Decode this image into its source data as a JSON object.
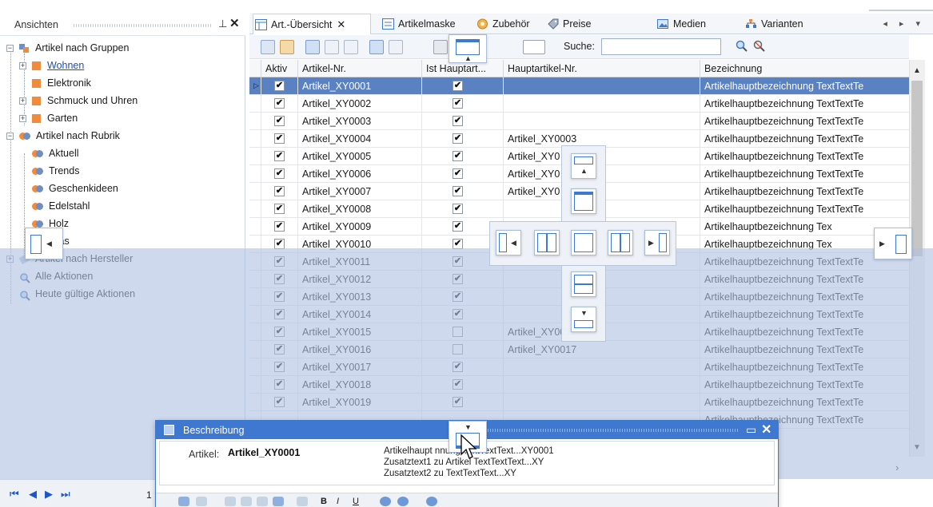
{
  "left_panel": {
    "title": "Ansichten",
    "tree": [
      {
        "label": "Artikel nach Gruppen",
        "level": 0,
        "expander": "−"
      },
      {
        "label": "Wohnen",
        "level": 1,
        "expander": "+"
      },
      {
        "label": "Elektronik",
        "level": 1,
        "expander": ""
      },
      {
        "label": "Schmuck und Uhren",
        "level": 1,
        "expander": "+"
      },
      {
        "label": "Garten",
        "level": 1,
        "expander": "+"
      },
      {
        "label": "Artikel nach Rubrik",
        "level": 0,
        "expander": "−"
      },
      {
        "label": "Aktuell",
        "level": 1,
        "expander": ""
      },
      {
        "label": "Trends",
        "level": 1,
        "expander": ""
      },
      {
        "label": "Geschenkideen",
        "level": 1,
        "expander": ""
      },
      {
        "label": "Edelstahl",
        "level": 1,
        "expander": ""
      },
      {
        "label": "Holz",
        "level": 1,
        "expander": ""
      },
      {
        "label": "Glas",
        "level": 1,
        "expander": ""
      },
      {
        "label": "Artikel nach Hersteller",
        "level": 0,
        "expander": "+"
      },
      {
        "label": "Alle Aktionen",
        "level": 0,
        "expander": ""
      },
      {
        "label": "Heute gültige Aktionen",
        "level": 0,
        "expander": ""
      }
    ]
  },
  "tabs": [
    {
      "label": "Art.-Übersicht",
      "close": "✕"
    },
    {
      "label": "Artikelmaske"
    },
    {
      "label": "Zubehör"
    },
    {
      "label": "Preise"
    },
    {
      "label": "Medien"
    },
    {
      "label": "Varianten"
    }
  ],
  "tab_nav": "◂ ▸ ▾",
  "toolbar": {
    "search_label": "Suche:",
    "search_value": ""
  },
  "grid": {
    "columns": [
      "Aktiv",
      "Artikel-Nr.",
      "Ist Hauptart...",
      "Hauptartikel-Nr.",
      "Bezeichnung"
    ],
    "rows": [
      {
        "aktiv": true,
        "nr": "Artikel_XY0001",
        "haupt": true,
        "haupt_nr": "",
        "bez": "Artikelhauptbezeichnung TextTextTe"
      },
      {
        "aktiv": true,
        "nr": "Artikel_XY0002",
        "haupt": true,
        "haupt_nr": "",
        "bez": "Artikelhauptbezeichnung TextTextTe"
      },
      {
        "aktiv": true,
        "nr": "Artikel_XY0003",
        "haupt": true,
        "haupt_nr": "",
        "bez": "Artikelhauptbezeichnung TextTextTe"
      },
      {
        "aktiv": true,
        "nr": "Artikel_XY0004",
        "haupt": true,
        "haupt_nr": "Artikel_XY0003",
        "bez": "Artikelhauptbezeichnung TextTextTe"
      },
      {
        "aktiv": true,
        "nr": "Artikel_XY0005",
        "haupt": true,
        "haupt_nr": "Artikel_XY0",
        "bez": "Artikelhauptbezeichnung TextTextTe"
      },
      {
        "aktiv": true,
        "nr": "Artikel_XY0006",
        "haupt": true,
        "haupt_nr": "Artikel_XY0",
        "bez": "Artikelhauptbezeichnung TextTextTe"
      },
      {
        "aktiv": true,
        "nr": "Artikel_XY0007",
        "haupt": true,
        "haupt_nr": "Artikel_XY0",
        "bez": "Artikelhauptbezeichnung TextTextTe"
      },
      {
        "aktiv": true,
        "nr": "Artikel_XY0008",
        "haupt": true,
        "haupt_nr": "",
        "bez": "Artikelhauptbezeichnung TextTextTe"
      },
      {
        "aktiv": true,
        "nr": "Artikel_XY0009",
        "haupt": true,
        "haupt_nr": "",
        "bez": "Artikelhauptbezeichnung Tex"
      },
      {
        "aktiv": true,
        "nr": "Artikel_XY0010",
        "haupt": true,
        "haupt_nr": "",
        "bez": "Artikelhauptbezeichnung Tex"
      },
      {
        "aktiv": true,
        "nr": "Artikel_XY0011",
        "haupt": true,
        "haupt_nr": "",
        "bez": "Artikelhauptbezeichnung TextTextTe"
      },
      {
        "aktiv": true,
        "nr": "Artikel_XY0012",
        "haupt": true,
        "haupt_nr": "",
        "bez": "Artikelhauptbezeichnung TextTextTe"
      },
      {
        "aktiv": true,
        "nr": "Artikel_XY0013",
        "haupt": true,
        "haupt_nr": "",
        "bez": "Artikelhauptbezeichnung TextTextTe"
      },
      {
        "aktiv": true,
        "nr": "Artikel_XY0014",
        "haupt": true,
        "haupt_nr": "",
        "bez": "Artikelhauptbezeichnung TextTextTe"
      },
      {
        "aktiv": true,
        "nr": "Artikel_XY0015",
        "haupt": false,
        "haupt_nr": "Artikel_XY0017",
        "bez": "Artikelhauptbezeichnung TextTextTe"
      },
      {
        "aktiv": true,
        "nr": "Artikel_XY0016",
        "haupt": false,
        "haupt_nr": "Artikel_XY0017",
        "bez": "Artikelhauptbezeichnung TextTextTe"
      },
      {
        "aktiv": true,
        "nr": "Artikel_XY0017",
        "haupt": true,
        "haupt_nr": "",
        "bez": "Artikelhauptbezeichnung TextTextTe"
      },
      {
        "aktiv": true,
        "nr": "Artikel_XY0018",
        "haupt": true,
        "haupt_nr": "",
        "bez": "Artikelhauptbezeichnung TextTextTe"
      },
      {
        "aktiv": true,
        "nr": "Artikel_XY0019",
        "haupt": true,
        "haupt_nr": "",
        "bez": "Artikelhauptbezeichnung TextTextTe"
      },
      {
        "aktiv": false,
        "nr": "",
        "haupt": false,
        "haupt_nr": "",
        "bez": "Artikelhauptbezeichnung TextTextTe"
      }
    ]
  },
  "navigator": {
    "page": "1"
  },
  "description_window": {
    "title": "Beschreibung",
    "artikel_label": "Artikel:",
    "artikel_value": "Artikel_XY0001",
    "lines": [
      "Artikelhaupt        nnung TextTextText...XY0001",
      "Zusatztext1 zu Artikel TextTextText...XY",
      "Zusatztext2 zu TextTextText...XY"
    ]
  },
  "colors": {
    "selection": "#5a81c2",
    "accent_blue": "#3f78d1",
    "dock_overlay": "#b0c2e2",
    "tree_orange": "#f08a3c"
  }
}
